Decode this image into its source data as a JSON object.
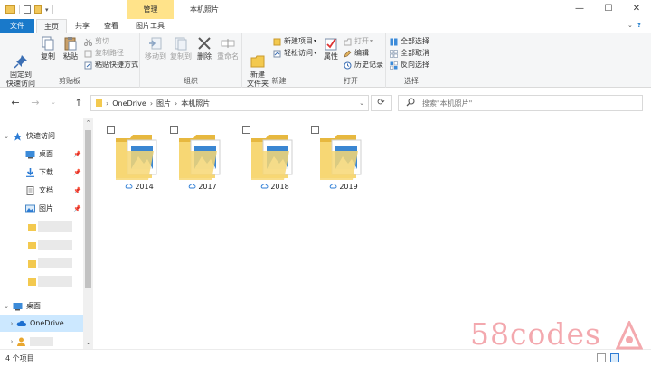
{
  "window": {
    "title": "本机照片",
    "context_tab": "管理",
    "buttons": [
      "—",
      "☐",
      "✕"
    ]
  },
  "tabs": [
    "文件",
    "主页",
    "共享",
    "查看",
    "图片工具"
  ],
  "ribbon": {
    "clipboard": {
      "label": "剪贴板",
      "pin": "固定到\n快速访问",
      "copy": "复制",
      "paste": "粘贴",
      "cut": "剪切",
      "copy_path": "复制路径",
      "paste_shortcut": "粘贴快捷方式"
    },
    "organize": {
      "label": "组织",
      "move_to": "移动到",
      "copy_to": "复制到",
      "delete": "删除",
      "rename": "重命名"
    },
    "new": {
      "label": "新建",
      "new_folder": "新建\n文件夹",
      "new_item": "新建项目",
      "easy_access": "轻松访问"
    },
    "open": {
      "label": "打开",
      "properties": "属性",
      "open": "打开",
      "edit": "编辑",
      "history": "历史记录"
    },
    "select": {
      "label": "选择",
      "select_all": "全部选择",
      "select_none": "全部取消",
      "invert": "反向选择"
    }
  },
  "address": {
    "crumbs": [
      "OneDrive",
      "图片",
      "本机照片"
    ],
    "search_placeholder": "搜索\"本机照片\""
  },
  "navpane": {
    "quick_access": "快速访问",
    "items": [
      "桌面",
      "下载",
      "文档",
      "图片"
    ],
    "desktop": "桌面",
    "onedrive": "OneDrive"
  },
  "folders": [
    "2014",
    "2017",
    "2018",
    "2019"
  ],
  "status": {
    "count": "4 个项目"
  },
  "watermark": "58codes",
  "colors": {
    "file_tab": "#1979ca",
    "manage_tab": "#ffe38a",
    "folder": "#f3c94f",
    "selection": "#cce8ff"
  }
}
